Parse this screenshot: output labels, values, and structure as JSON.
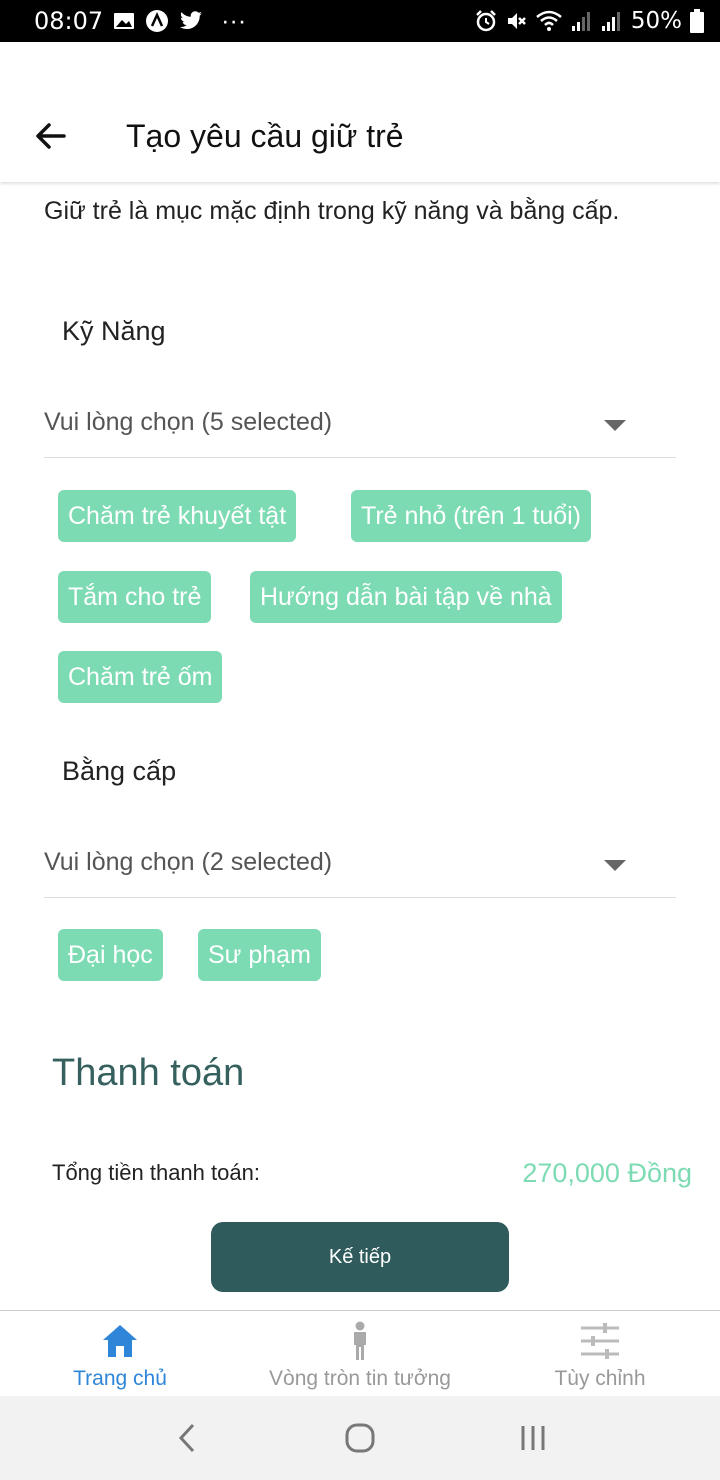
{
  "status_bar": {
    "time": "08:07",
    "more": "···",
    "battery": "50%"
  },
  "header": {
    "title": "Tạo yêu cầu giữ trẻ"
  },
  "intro_text": "Giữ trẻ là mục mặc định trong kỹ năng và bằng cấp.",
  "skills": {
    "label": "Kỹ Năng",
    "dropdown_text": "Vui lòng chọn (5 selected)",
    "chips": [
      "Chăm trẻ khuyết tật",
      "Trẻ nhỏ (trên 1 tuổi)",
      "Tắm cho trẻ",
      "Hướng dẫn bài tập về nhà",
      "Chăm trẻ ốm"
    ]
  },
  "degrees": {
    "label": "Bằng cấp",
    "dropdown_text": "Vui lòng chọn (2 selected)",
    "chips": [
      "Đại học",
      "Sư phạm"
    ]
  },
  "payment": {
    "title": "Thanh toán",
    "total_label": "Tổng tiền thanh toán:",
    "total_value": "270,000 Đồng",
    "next_button": "Kế tiếp"
  },
  "bottom_nav": {
    "items": [
      {
        "label": "Trang chủ",
        "icon": "home-icon",
        "active": true
      },
      {
        "label": "Vòng tròn tin tưởng",
        "icon": "person-icon",
        "active": false
      },
      {
        "label": "Tùy chỉnh",
        "icon": "sliders-icon",
        "active": false
      }
    ]
  },
  "colors": {
    "chip": "#7ddbb3",
    "primary_dark": "#2f5b5c",
    "active_nav": "#2f86d9"
  }
}
